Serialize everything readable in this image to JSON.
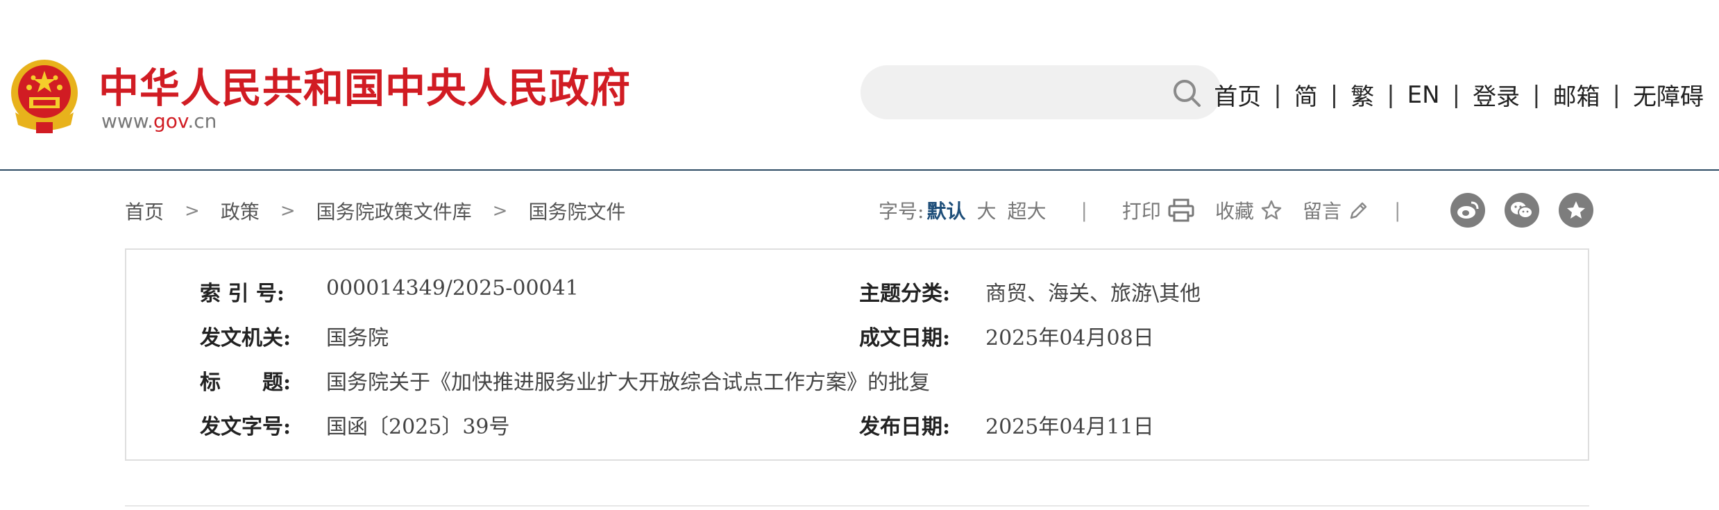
{
  "header": {
    "site_title": "中华人民共和国中央人民政府",
    "site_url_pre": "www.",
    "site_url_mid": "gov",
    "site_url_post": ".cn",
    "search_placeholder": "",
    "nav": [
      "首页",
      "简",
      "繁",
      "EN",
      "登录",
      "邮箱",
      "无障碍"
    ],
    "nav_separator": "|"
  },
  "breadcrumb": {
    "items": [
      "首页",
      "政策",
      "国务院政策文件库",
      "国务院文件"
    ],
    "arrow": ">"
  },
  "tools": {
    "font_size_label": "字号:",
    "font_default": "默认",
    "font_large": "大",
    "font_xlarge": "超大",
    "divider": "|",
    "print": "打印",
    "favorite": "收藏",
    "comment": "留言"
  },
  "share_icons": [
    "weibo-icon",
    "wechat-icon",
    "star-share-icon"
  ],
  "info": {
    "index_label": "索 引 号:",
    "index_value": "000014349/2025-00041",
    "topic_label": "主题分类:",
    "topic_value": "商贸、海关、旅游\\其他",
    "issuer_label": "发文机关:",
    "issuer_value": "国务院",
    "written_date_label": "成文日期:",
    "written_date_value": "2025年04月08日",
    "title_label": "标　　题:",
    "title_value": "国务院关于《加快推进服务业扩大开放综合试点工作方案》的批复",
    "doc_no_label": "发文字号:",
    "doc_no_value": "国函〔2025〕39号",
    "publish_date_label": "发布日期:",
    "publish_date_value": "2025年04月11日"
  },
  "colors": {
    "brand_red": "#d11c23",
    "accent_blue": "#1f4f7a",
    "header_border": "#2b4a63"
  }
}
